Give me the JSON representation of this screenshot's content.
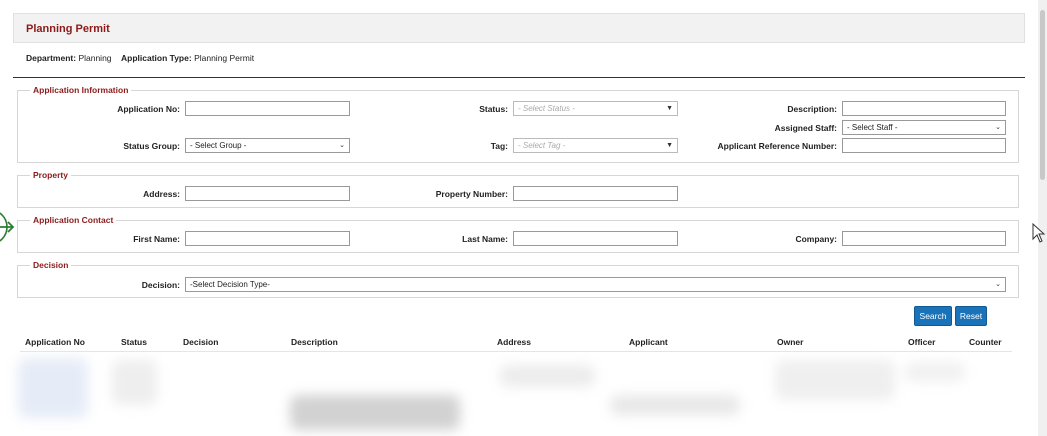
{
  "page": {
    "title": "Planning Permit"
  },
  "meta": {
    "department_label": "Department:",
    "department_value": "Planning",
    "app_type_label": "Application Type:",
    "app_type_value": "Planning Permit"
  },
  "sections": {
    "application_information": {
      "legend": "Application Information",
      "application_no_label": "Application No:",
      "status_label": "Status:",
      "status_placeholder": "- Select Status -",
      "description_label": "Description:",
      "assigned_staff_label": "Assigned Staff:",
      "assigned_staff_value": "- Select Staff -",
      "status_group_label": "Status Group:",
      "status_group_value": "- Select Group -",
      "tag_label": "Tag:",
      "tag_placeholder": "- Select Tag -",
      "applicant_ref_label": "Applicant Reference Number:"
    },
    "property": {
      "legend": "Property",
      "address_label": "Address:",
      "property_number_label": "Property Number:"
    },
    "application_contact": {
      "legend": "Application Contact",
      "first_name_label": "First Name:",
      "last_name_label": "Last Name:",
      "company_label": "Company:"
    },
    "decision": {
      "legend": "Decision",
      "decision_label": "Decision:",
      "decision_value": "-Select Decision Type-"
    }
  },
  "buttons": {
    "search": "Search",
    "reset": "Reset"
  },
  "table": {
    "columns": [
      "Application No",
      "Status",
      "Decision",
      "Description",
      "Address",
      "Applicant",
      "Owner",
      "Officer",
      "Counter"
    ]
  },
  "colors": {
    "accent": "#8b1a1a",
    "button": "#1a73b8"
  }
}
